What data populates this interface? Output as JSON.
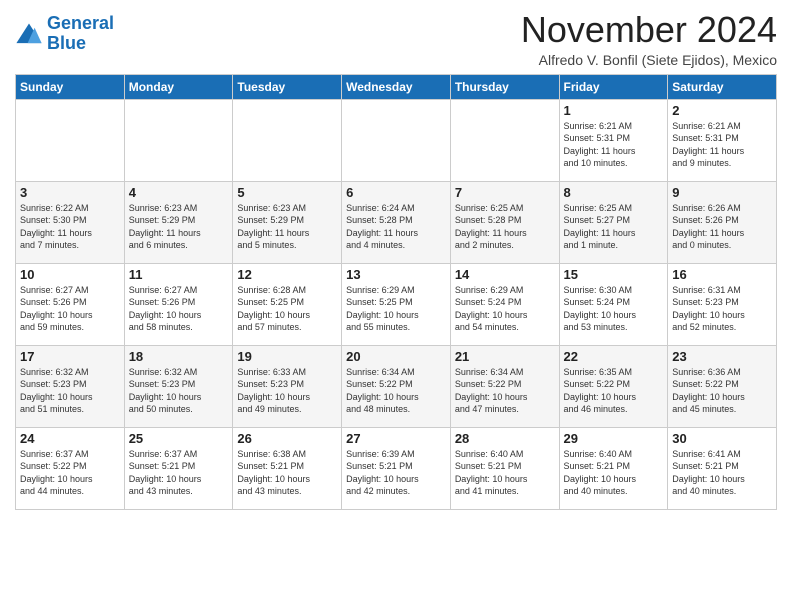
{
  "logo": {
    "line1": "General",
    "line2": "Blue"
  },
  "header": {
    "month": "November 2024",
    "location": "Alfredo V. Bonfil (Siete Ejidos), Mexico"
  },
  "weekdays": [
    "Sunday",
    "Monday",
    "Tuesday",
    "Wednesday",
    "Thursday",
    "Friday",
    "Saturday"
  ],
  "weeks": [
    [
      {
        "day": "",
        "info": ""
      },
      {
        "day": "",
        "info": ""
      },
      {
        "day": "",
        "info": ""
      },
      {
        "day": "",
        "info": ""
      },
      {
        "day": "",
        "info": ""
      },
      {
        "day": "1",
        "info": "Sunrise: 6:21 AM\nSunset: 5:31 PM\nDaylight: 11 hours\nand 10 minutes."
      },
      {
        "day": "2",
        "info": "Sunrise: 6:21 AM\nSunset: 5:31 PM\nDaylight: 11 hours\nand 9 minutes."
      }
    ],
    [
      {
        "day": "3",
        "info": "Sunrise: 6:22 AM\nSunset: 5:30 PM\nDaylight: 11 hours\nand 7 minutes."
      },
      {
        "day": "4",
        "info": "Sunrise: 6:23 AM\nSunset: 5:29 PM\nDaylight: 11 hours\nand 6 minutes."
      },
      {
        "day": "5",
        "info": "Sunrise: 6:23 AM\nSunset: 5:29 PM\nDaylight: 11 hours\nand 5 minutes."
      },
      {
        "day": "6",
        "info": "Sunrise: 6:24 AM\nSunset: 5:28 PM\nDaylight: 11 hours\nand 4 minutes."
      },
      {
        "day": "7",
        "info": "Sunrise: 6:25 AM\nSunset: 5:28 PM\nDaylight: 11 hours\nand 2 minutes."
      },
      {
        "day": "8",
        "info": "Sunrise: 6:25 AM\nSunset: 5:27 PM\nDaylight: 11 hours\nand 1 minute."
      },
      {
        "day": "9",
        "info": "Sunrise: 6:26 AM\nSunset: 5:26 PM\nDaylight: 11 hours\nand 0 minutes."
      }
    ],
    [
      {
        "day": "10",
        "info": "Sunrise: 6:27 AM\nSunset: 5:26 PM\nDaylight: 10 hours\nand 59 minutes."
      },
      {
        "day": "11",
        "info": "Sunrise: 6:27 AM\nSunset: 5:26 PM\nDaylight: 10 hours\nand 58 minutes."
      },
      {
        "day": "12",
        "info": "Sunrise: 6:28 AM\nSunset: 5:25 PM\nDaylight: 10 hours\nand 57 minutes."
      },
      {
        "day": "13",
        "info": "Sunrise: 6:29 AM\nSunset: 5:25 PM\nDaylight: 10 hours\nand 55 minutes."
      },
      {
        "day": "14",
        "info": "Sunrise: 6:29 AM\nSunset: 5:24 PM\nDaylight: 10 hours\nand 54 minutes."
      },
      {
        "day": "15",
        "info": "Sunrise: 6:30 AM\nSunset: 5:24 PM\nDaylight: 10 hours\nand 53 minutes."
      },
      {
        "day": "16",
        "info": "Sunrise: 6:31 AM\nSunset: 5:23 PM\nDaylight: 10 hours\nand 52 minutes."
      }
    ],
    [
      {
        "day": "17",
        "info": "Sunrise: 6:32 AM\nSunset: 5:23 PM\nDaylight: 10 hours\nand 51 minutes."
      },
      {
        "day": "18",
        "info": "Sunrise: 6:32 AM\nSunset: 5:23 PM\nDaylight: 10 hours\nand 50 minutes."
      },
      {
        "day": "19",
        "info": "Sunrise: 6:33 AM\nSunset: 5:23 PM\nDaylight: 10 hours\nand 49 minutes."
      },
      {
        "day": "20",
        "info": "Sunrise: 6:34 AM\nSunset: 5:22 PM\nDaylight: 10 hours\nand 48 minutes."
      },
      {
        "day": "21",
        "info": "Sunrise: 6:34 AM\nSunset: 5:22 PM\nDaylight: 10 hours\nand 47 minutes."
      },
      {
        "day": "22",
        "info": "Sunrise: 6:35 AM\nSunset: 5:22 PM\nDaylight: 10 hours\nand 46 minutes."
      },
      {
        "day": "23",
        "info": "Sunrise: 6:36 AM\nSunset: 5:22 PM\nDaylight: 10 hours\nand 45 minutes."
      }
    ],
    [
      {
        "day": "24",
        "info": "Sunrise: 6:37 AM\nSunset: 5:22 PM\nDaylight: 10 hours\nand 44 minutes."
      },
      {
        "day": "25",
        "info": "Sunrise: 6:37 AM\nSunset: 5:21 PM\nDaylight: 10 hours\nand 43 minutes."
      },
      {
        "day": "26",
        "info": "Sunrise: 6:38 AM\nSunset: 5:21 PM\nDaylight: 10 hours\nand 43 minutes."
      },
      {
        "day": "27",
        "info": "Sunrise: 6:39 AM\nSunset: 5:21 PM\nDaylight: 10 hours\nand 42 minutes."
      },
      {
        "day": "28",
        "info": "Sunrise: 6:40 AM\nSunset: 5:21 PM\nDaylight: 10 hours\nand 41 minutes."
      },
      {
        "day": "29",
        "info": "Sunrise: 6:40 AM\nSunset: 5:21 PM\nDaylight: 10 hours\nand 40 minutes."
      },
      {
        "day": "30",
        "info": "Sunrise: 6:41 AM\nSunset: 5:21 PM\nDaylight: 10 hours\nand 40 minutes."
      }
    ]
  ]
}
